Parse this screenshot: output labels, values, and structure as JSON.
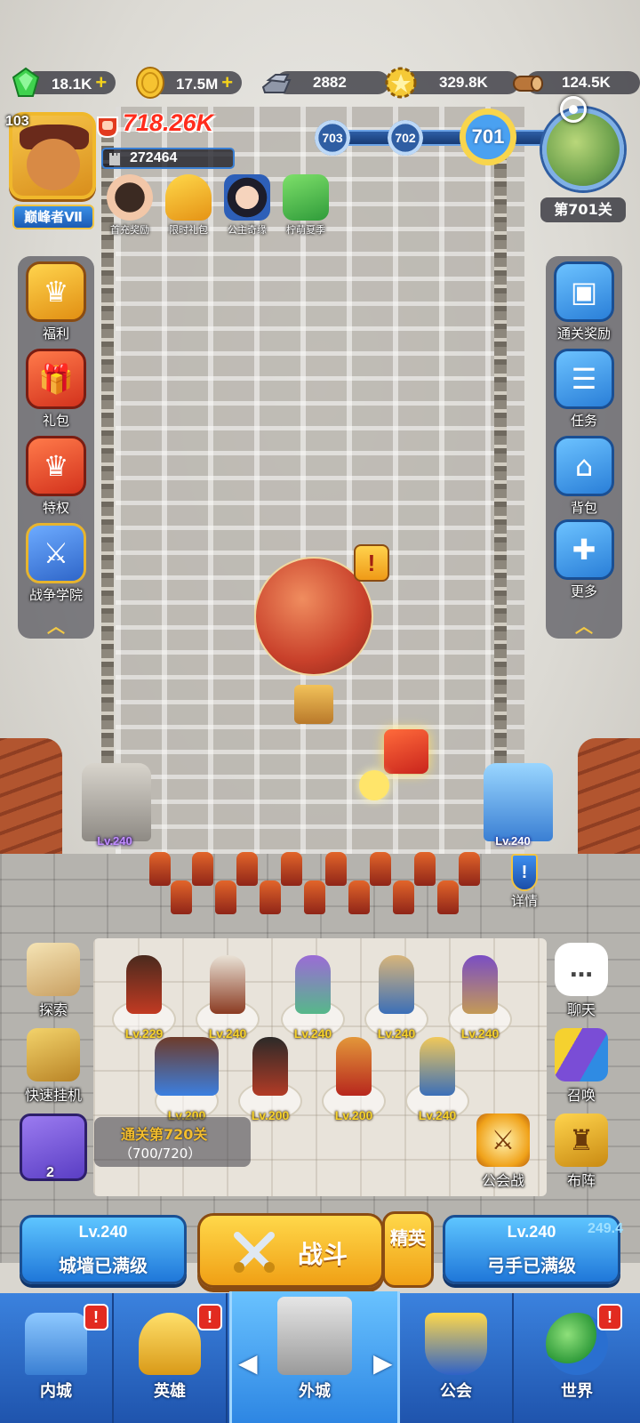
{
  "resources": {
    "gems": "18.1K",
    "gold": "17.5M",
    "iron": "2882",
    "medal": "329.8K",
    "wood": "124.5K"
  },
  "player": {
    "level": "103",
    "rank": "巅峰者Ⅶ",
    "power": "718.26K",
    "sub_power": "272464"
  },
  "events": [
    {
      "label": "首充奖励",
      "icon": "first-recharge-icon"
    },
    {
      "label": "限时礼包",
      "icon": "limited-pack-icon"
    },
    {
      "label": "公主奇缘",
      "icon": "princess-icon"
    },
    {
      "label": "柠萌夏季",
      "icon": "lemon-summer-icon"
    }
  ],
  "stages": {
    "prev2": "703",
    "prev1": "702",
    "current": "701",
    "current_label": "第701关"
  },
  "left_menu": [
    {
      "label": "福利",
      "icon": "crown-badge-icon"
    },
    {
      "label": "礼包",
      "icon": "gift-icon"
    },
    {
      "label": "特权",
      "icon": "privilege-crown-icon"
    },
    {
      "label": "战争学院",
      "icon": "war-academy-icon"
    }
  ],
  "right_menu": [
    {
      "label": "通关奖励",
      "icon": "reward-box-icon"
    },
    {
      "label": "任务",
      "icon": "scroll-icon"
    },
    {
      "label": "背包",
      "icon": "backpack-icon"
    },
    {
      "label": "更多",
      "icon": "plus-icon"
    }
  ],
  "towers": {
    "left_level": "Lv.240",
    "right_level": "Lv.240",
    "detail_label": "详情"
  },
  "heroes_row1": [
    "Lv.229",
    "Lv.240",
    "Lv.240",
    "Lv.240",
    "Lv.240"
  ],
  "heroes_row2": [
    "Lv.200",
    "Lv.200",
    "Lv.200",
    "Lv.240"
  ],
  "side_actions": {
    "explore": "探索",
    "quick_idle": "快速挂机",
    "chat": "聊天",
    "summon": "召唤",
    "guild_war": "公会战",
    "formation": "布阵"
  },
  "chest": {
    "count": "2",
    "progress_title": "通关第720关",
    "progress_value": "（700/720）"
  },
  "wall": {
    "level": "Lv.240",
    "status": "城墙已满级"
  },
  "battle_label": "战斗",
  "elite_label": "精英",
  "archer": {
    "level": "Lv.240",
    "extra": "249.4",
    "status": "弓手已满级"
  },
  "nav": [
    {
      "label": "内城",
      "badge": "!"
    },
    {
      "label": "英雄",
      "badge": "!"
    },
    {
      "label": "外城",
      "badge": ""
    },
    {
      "label": "公会",
      "badge": ""
    },
    {
      "label": "世界",
      "badge": "!"
    }
  ],
  "colors": {
    "accent_gold": "#f3bd2d",
    "power_red": "#ff2c1c",
    "nav_blue": "#2d6fd0",
    "hero_level": "#f6d22c"
  }
}
